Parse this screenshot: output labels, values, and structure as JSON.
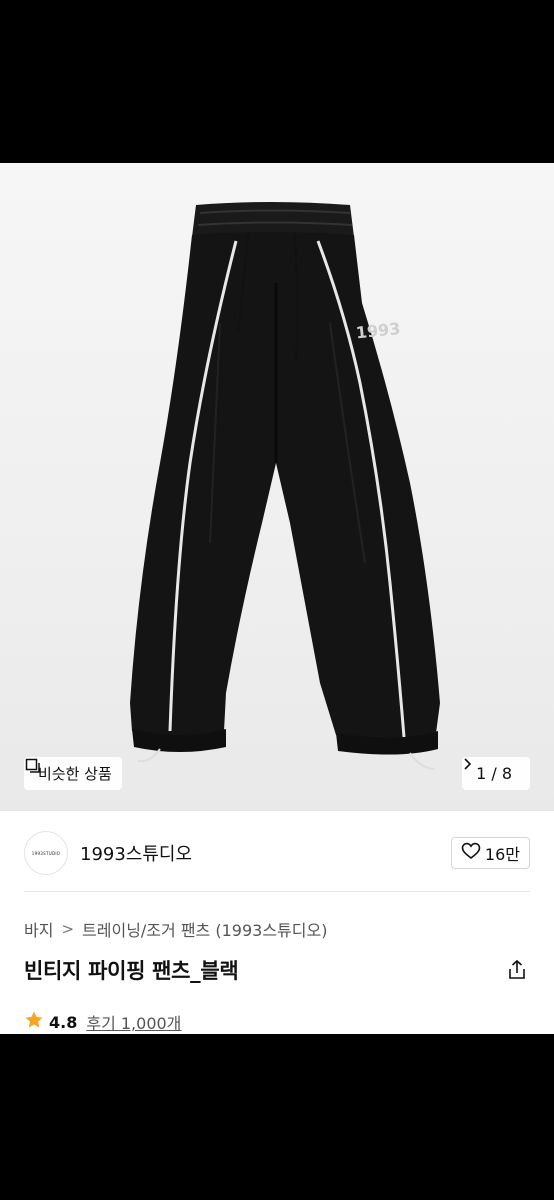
{
  "gallery": {
    "logo_print": "1993",
    "similar_label": "비슷한 상품",
    "counter": "1 / 8"
  },
  "brand": {
    "name": "1993스튜디오",
    "logo_text": "1993STUDIO",
    "likes": "16만"
  },
  "breadcrumb": {
    "category": "바지",
    "subcategory": "트레이닝/조거 팬츠 (1993스튜디오)"
  },
  "product": {
    "title": "빈티지 파이핑 팬츠_블랙",
    "rating": "4.8",
    "reviews": "후기 1,000개"
  },
  "colors": {
    "star": "#F5A623",
    "text": "#111111",
    "pants": "#141414",
    "piping": "#e8e8e8"
  }
}
